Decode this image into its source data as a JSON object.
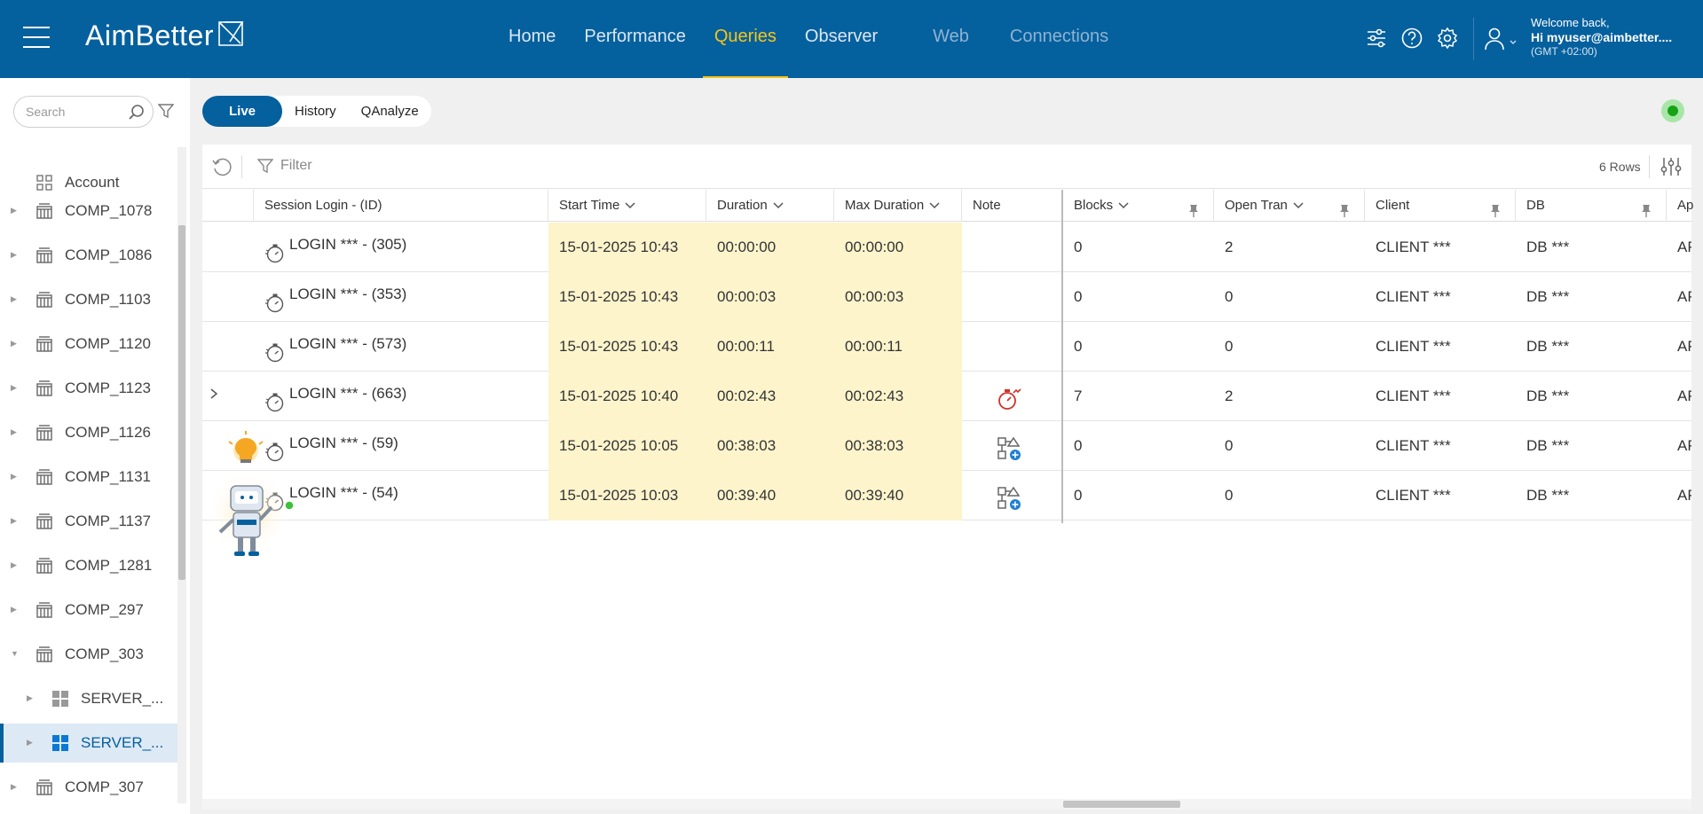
{
  "header": {
    "logo": "AimBetter",
    "nav": [
      {
        "label": "Home",
        "state": "normal"
      },
      {
        "label": "Performance",
        "state": "normal"
      },
      {
        "label": "Queries",
        "state": "active"
      },
      {
        "label": "Observer",
        "state": "normal"
      },
      {
        "label": "Web",
        "state": "dim"
      },
      {
        "label": "Connections",
        "state": "dim"
      }
    ],
    "icons": [
      "sliders-icon",
      "help-icon",
      "gear-icon"
    ],
    "welcome": "Welcome back,",
    "user": "Hi myuser@aimbetter....",
    "timezone": "(GMT +02:00)"
  },
  "sidebar": {
    "search_placeholder": "Search",
    "items": [
      {
        "label": "Account",
        "icon": "grid-icon",
        "level": 0,
        "arrow": ""
      },
      {
        "label": "COMP_1078",
        "icon": "building-icon",
        "level": 0,
        "arrow": "right"
      },
      {
        "label": "COMP_1086",
        "icon": "building-icon",
        "level": 0,
        "arrow": "right"
      },
      {
        "label": "COMP_1103",
        "icon": "building-icon",
        "level": 0,
        "arrow": "right"
      },
      {
        "label": "COMP_1120",
        "icon": "building-icon",
        "level": 0,
        "arrow": "right"
      },
      {
        "label": "COMP_1123",
        "icon": "building-icon",
        "level": 0,
        "arrow": "right"
      },
      {
        "label": "COMP_1126",
        "icon": "building-icon",
        "level": 0,
        "arrow": "right"
      },
      {
        "label": "COMP_1131",
        "icon": "building-icon",
        "level": 0,
        "arrow": "right"
      },
      {
        "label": "COMP_1137",
        "icon": "building-icon",
        "level": 0,
        "arrow": "right"
      },
      {
        "label": "COMP_1281",
        "icon": "building-icon",
        "level": 0,
        "arrow": "right"
      },
      {
        "label": "COMP_297",
        "icon": "building-icon",
        "level": 0,
        "arrow": "right"
      },
      {
        "label": "COMP_303",
        "icon": "building-icon",
        "level": 0,
        "arrow": "down"
      },
      {
        "label": "SERVER_...",
        "icon": "windows-icon-gray",
        "level": 1,
        "arrow": "right"
      },
      {
        "label": "SERVER_...",
        "icon": "windows-icon-blue",
        "level": 1,
        "arrow": "right",
        "selected": true
      },
      {
        "label": "COMP_307",
        "icon": "building-icon",
        "level": 0,
        "arrow": "right"
      }
    ]
  },
  "tabs": [
    "Live",
    "History",
    "QAnalyze"
  ],
  "toolbar": {
    "filter_label": "Filter",
    "row_count": "6 Rows"
  },
  "table": {
    "columns": [
      "Session Login - (ID)",
      "Start Time",
      "Duration",
      "Max Duration",
      "Note",
      "Blocks",
      "Open Tran",
      "Client",
      "DB",
      "Ap"
    ],
    "rows": [
      {
        "login": "LOGIN *** - (305)",
        "start": "15-01-2025 10:43",
        "duration": "00:00:00",
        "max": "00:00:00",
        "note": "",
        "blocks": "0",
        "open": "2",
        "client": "CLIENT ***",
        "db": "DB ***",
        "ap": "AP"
      },
      {
        "login": "LOGIN *** - (353)",
        "start": "15-01-2025 10:43",
        "duration": "00:00:03",
        "max": "00:00:03",
        "note": "",
        "blocks": "0",
        "open": "0",
        "client": "CLIENT ***",
        "db": "DB ***",
        "ap": "AP"
      },
      {
        "login": "LOGIN *** - (573)",
        "start": "15-01-2025 10:43",
        "duration": "00:00:11",
        "max": "00:00:11",
        "note": "",
        "blocks": "0",
        "open": "0",
        "client": "CLIENT ***",
        "db": "DB ***",
        "ap": "AP"
      },
      {
        "login": "LOGIN *** - (663)",
        "start": "15-01-2025 10:40",
        "duration": "00:02:43",
        "max": "00:02:43",
        "note": "stopwatch-alert-icon",
        "blocks": "7",
        "open": "2",
        "client": "CLIENT ***",
        "db": "DB ***",
        "ap": "AP"
      },
      {
        "login": "LOGIN *** - (59)",
        "start": "15-01-2025 10:05",
        "duration": "00:38:03",
        "max": "00:38:03",
        "note": "plan-icon",
        "blocks": "0",
        "open": "0",
        "client": "CLIENT ***",
        "db": "DB ***",
        "ap": "AP"
      },
      {
        "login": "LOGIN *** - (54)",
        "start": "15-01-2025 10:03",
        "duration": "00:39:40",
        "max": "00:39:40",
        "note": "plan-icon",
        "blocks": "0",
        "open": "0",
        "client": "CLIENT ***",
        "db": "DB ***",
        "ap": "AP"
      }
    ]
  },
  "colors": {
    "brand": "#05609e",
    "active_nav": "#f5c518",
    "highlight": "#fdf4cc",
    "status": "#16a316"
  }
}
